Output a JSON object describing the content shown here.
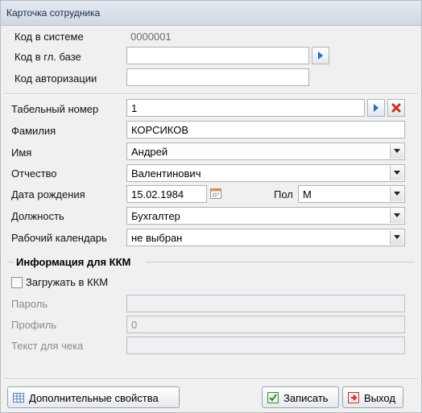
{
  "window": {
    "title": "Карточка сотрудника"
  },
  "codes": {
    "system_code_label": "Код в системе",
    "system_code_value": "0000001",
    "main_db_code_label": "Код в гл. базе",
    "main_db_code_value": "",
    "auth_code_label": "Код авторизации",
    "auth_code_value": ""
  },
  "employee": {
    "tab_number_label": "Табельный номер",
    "tab_number_value": "1",
    "last_name_label": "Фамилия",
    "last_name_value": "КОРСИКОВ",
    "first_name_label": "Имя",
    "first_name_value": "Андрей",
    "patronymic_label": "Отчество",
    "patronymic_value": "Валентинович",
    "birth_date_label": "Дата рождения",
    "birth_date_value": "15.02.1984",
    "sex_label": "Пол",
    "sex_value": "М",
    "position_label": "Должность",
    "position_value": "Бухгалтер",
    "calendar_label": "Рабочий календарь",
    "calendar_value": "не выбран"
  },
  "kkm": {
    "group_title": "Информация для ККМ",
    "load_label": "Загружать в ККМ",
    "load_checked": false,
    "password_label": "Пароль",
    "password_value": "",
    "profile_label": "Профиль",
    "profile_value": "0",
    "receipt_text_label": "Текст для чека",
    "receipt_text_value": ""
  },
  "footer": {
    "extra_props_label": "Дополнительные свойства",
    "save_label": "Записать",
    "exit_label": "Выход"
  },
  "colors": {
    "accent": "#1f6fd1",
    "clear_red": "#d22b1f",
    "disabled_text": "#8a8a8a"
  }
}
